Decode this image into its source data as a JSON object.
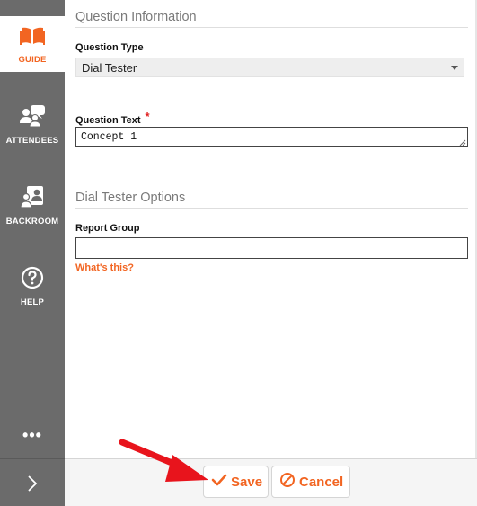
{
  "sidebar": {
    "items": [
      {
        "label": "GUIDE",
        "icon": "book-icon",
        "active": true
      },
      {
        "label": "ATTENDEES",
        "icon": "people-chat-icon",
        "active": false
      },
      {
        "label": "BACKROOM",
        "icon": "backroom-icon",
        "active": false
      },
      {
        "label": "HELP",
        "icon": "help-circle-icon",
        "active": false
      }
    ],
    "more_label": "•••",
    "expand_icon": "chevron-right-icon"
  },
  "form": {
    "question_info_title": "Question Information",
    "question_type_label": "Question Type",
    "question_type_value": "Dial Tester",
    "question_text_label": "Question Text",
    "required_marker": "*",
    "question_text_value": "Concept 1",
    "options_title": "Dial Tester Options",
    "report_group_label": "Report Group",
    "report_group_value": "",
    "whats_this_link": "What's this?"
  },
  "footer": {
    "save_label": "Save",
    "cancel_label": "Cancel"
  },
  "colors": {
    "accent": "#f26522",
    "sidebar_bg": "#6b6b6b",
    "required": "#e02020",
    "annotation_arrow": "#e8141c"
  }
}
